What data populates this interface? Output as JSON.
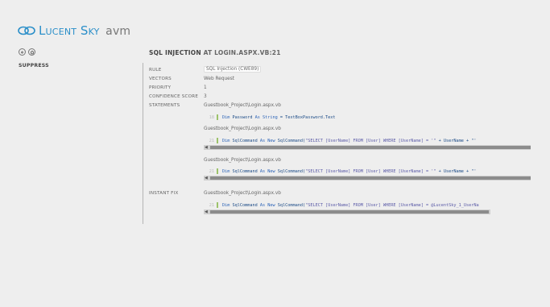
{
  "app": {
    "logo_lucent": "Lucent",
    "logo_sky": "Sky",
    "logo_avm": "avm"
  },
  "nav": {
    "back_icon": "arrow-left-icon",
    "home_icon": "home-icon"
  },
  "sidebar": {
    "suppress_label": "SUPPRESS"
  },
  "issue": {
    "title": "SQL INJECTION",
    "title_at": "AT LOGIN.ASPX.VB:21",
    "rule_label": "RULE",
    "rule_value": "SQL Injection (CWE89)",
    "vectors_label": "VECTORS",
    "vectors_value": "Web Request",
    "priority_label": "PRIORITY",
    "priority_value": "1",
    "confidence_label": "CONFIDENCE SCORE",
    "confidence_value": "3",
    "statements_label": "STATEMENTS",
    "instant_fix_label": "INSTANT FIX"
  },
  "statements": [
    {
      "file": "Guestbook_Project\\Login.aspx.vb",
      "line": "18",
      "kw1": "Dim",
      "rest1": " Password ",
      "kw2": "As String",
      "rest2": " = TextBoxPassword.Text"
    },
    {
      "file": "Guestbook_Project\\Login.aspx.vb",
      "line": "21",
      "kw1": "Dim",
      "rest1": " SqlCommand ",
      "kw2": "As New",
      "rest2": " SqlCommand(",
      "str": "\"SELECT [UserName] FROM [User] WHERE [UserName] = '\"",
      "rest3": " + UserName + \"'"
    },
    {
      "file": "Guestbook_Project\\Login.aspx.vb",
      "line": "21",
      "kw1": "Dim",
      "rest1": " SqlCommand ",
      "kw2": "As New",
      "rest2": " SqlCommand(",
      "str": "\"SELECT [UserName] FROM [User] WHERE [UserName] = '\"",
      "rest3": " + UserName + \"'"
    }
  ],
  "fix": {
    "file": "Guestbook_Project\\Login.aspx.vb",
    "line": "21",
    "kw1": "Dim",
    "rest1": " SqlCommand ",
    "kw2": "As New",
    "rest2": " SqlCommand(",
    "str": "\"SELECT [UserName] FROM [User] WHERE [UserName] = @LucentSky_1_UserNa"
  },
  "colors": {
    "brand": "#2b8fc9",
    "background": "#eeeeee",
    "code_bar": "#9cc26a"
  }
}
